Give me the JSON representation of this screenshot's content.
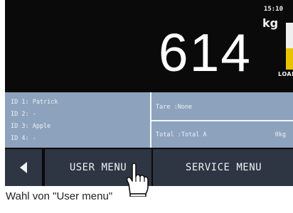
{
  "header": {
    "time": "15:10",
    "unit": "kg",
    "load_label": "LOAD"
  },
  "display": {
    "weight": "614",
    "load_fraction": 0.45,
    "load_color": "#e8c400"
  },
  "ids": [
    {
      "text": "ID 1: Patrick"
    },
    {
      "text": "ID 2: -"
    },
    {
      "text": "ID 3: Apple"
    },
    {
      "text": "ID 4: -"
    }
  ],
  "summary": {
    "tare": "Tare  :None",
    "total": "Total :Total A",
    "total_value": "0kg"
  },
  "buttons": {
    "user_menu": "USER MENU",
    "service_menu": "SERVICE MENU"
  },
  "caption": "Wahl von \"User menu\""
}
